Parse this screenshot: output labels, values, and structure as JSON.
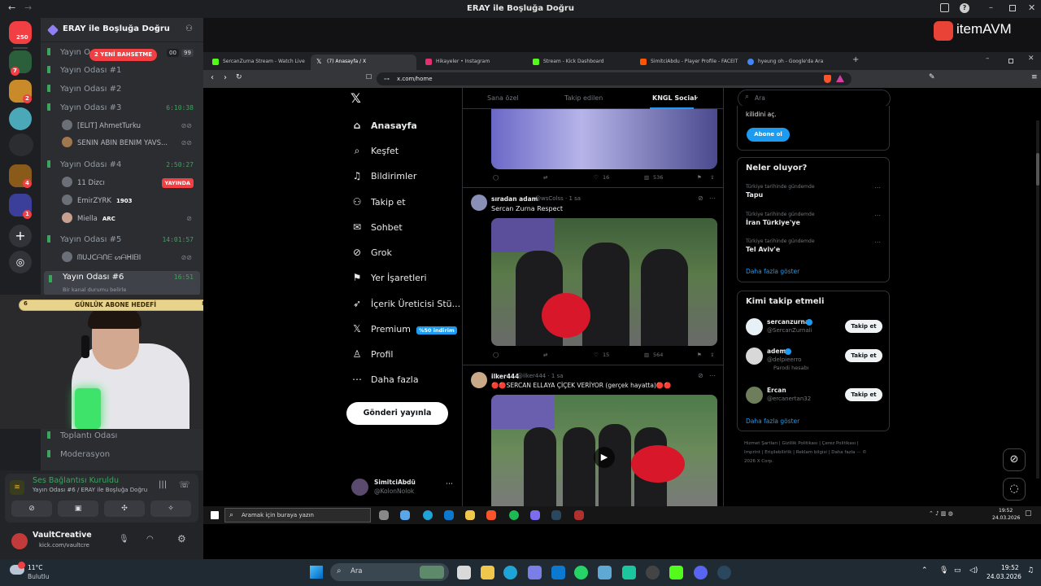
{
  "window": {
    "title": "ERAY ile Boşluğa Doğru"
  },
  "brand": {
    "name": "itemAVM",
    "accent": "#e84336"
  },
  "servers": {
    "home_badge": "250",
    "badges": [
      "7",
      "4",
      "2",
      "4",
      "1"
    ]
  },
  "channels": {
    "server_name": "ERAY ile Boşluğa Doğru",
    "new_mentions": "2 YENİ BAHSETME",
    "stage_count_a": "00",
    "stage_count_b": "99",
    "items": [
      {
        "label": "Yayın O",
        "time": ""
      },
      {
        "label": "Yayın Odası #1",
        "time": ""
      },
      {
        "label": "Yayın Odası #2",
        "time": ""
      },
      {
        "label": "Yayın Odası #3",
        "time": "6:10:38"
      },
      {
        "label": "Yayın Odası #4",
        "time": "2:50:27"
      },
      {
        "label": "Yayın Odası #5",
        "time": "14:01:57"
      },
      {
        "label": "Yayın Odası #6",
        "time": "16:51"
      },
      {
        "label": "Toplantı Odası",
        "time": ""
      },
      {
        "label": "Moderasyon",
        "time": ""
      }
    ],
    "room3_users": [
      "[ELIT] AhmetTurku",
      "SENIN ABIN BENIM YAVS..."
    ],
    "room4_users": [
      "11 Dizcı",
      "EmirZYRK",
      "Miella"
    ],
    "room4_badges": [
      "YAYINDA",
      "1903",
      "ARC"
    ],
    "room5_users": [
      "ᗰᑌᒍᑕᗩᑎᗴ ᔕᗩᕼIᗷI"
    ],
    "room6_status": "Bir kanal durumu belirle"
  },
  "overlay": {
    "goal_text": "GÜNLÜK ABONE HEDEFİ",
    "goal_left": "6",
    "goal_right": "8"
  },
  "voice_panel": {
    "status": "Ses Bağlantısı Kuruldu",
    "location": "Yayın Odası #6 / ERAY ile Boşluğa Doğru",
    "username": "VaultCreative",
    "user_status": "kick.com/vaultcre"
  },
  "browser": {
    "tabs": [
      {
        "label": "SercanZurna Stream - Watch Live",
        "color": "#53fc18"
      },
      {
        "label": "(7) Anasayfa / X",
        "color": "#ffffff"
      },
      {
        "label": "Hikayeler • Instagram",
        "color": "#e1306c"
      },
      {
        "label": "Stream - Kick Dashboard",
        "color": "#53fc18"
      },
      {
        "label": "SimitciAbdu - Player Profile - FACEIT",
        "color": "#ff5500"
      },
      {
        "label": "hyeung oh - Google'da Ara",
        "color": "#4285f4"
      }
    ],
    "url": "x.com/home"
  },
  "x": {
    "nav": [
      "Anasayfa",
      "Keşfet",
      "Bildirimler",
      "Takip et",
      "Sohbet",
      "Grok",
      "Yer İşaretleri",
      "İçerik Üreticisi Stü...",
      "Premium",
      "Profil",
      "Daha fazla"
    ],
    "premium_badge": "%50 indirim",
    "post_button": "Gönderi yayınla",
    "profile_name": "SimitciAbdü",
    "profile_handle": "@KolonNolok",
    "feed_tabs": [
      "Sana özel",
      "Takip edilen",
      "KNGL Social"
    ],
    "tweet0_stats": {
      "likes": "16",
      "views": "536"
    },
    "tweet1": {
      "name": "sıradan adam",
      "handle": "@wsColss · 1 sa",
      "text": "Sercan Zurna Respect",
      "likes": "15",
      "views": "564"
    },
    "tweet2": {
      "name": "ilker444",
      "handle": "@ilker444 · 1 sa",
      "text": "🔴🔴SERCAN ELLAYA ÇİÇEK VERİYOR (gerçek hayatta)🔴🔴"
    },
    "search_placeholder": "Ara",
    "subscribe_text": "kilidini aç.",
    "subscribe_button": "Abone ol",
    "trends_title": "Neler oluyor?",
    "trends": [
      {
        "meta": "Türkiye tarihinde gündemde",
        "name": "Tapu"
      },
      {
        "meta": "Türkiye tarihinde gündemde",
        "name": "İran Türkiye'ye"
      },
      {
        "meta": "Türkiye tarihinde gündemde",
        "name": "Tel Aviv'e"
      }
    ],
    "show_more": "Daha fazla göster",
    "wtf_title": "Kimi takip etmeli",
    "follow_label": "Takip et",
    "suggestions": [
      {
        "name": "sercanzurna",
        "handle": "@SercanZurnali",
        "extra": ""
      },
      {
        "name": "adem",
        "handle": "@delpieerro",
        "extra": "Parodi hesabı"
      },
      {
        "name": "Ercan",
        "handle": "@ercanertan32",
        "extra": ""
      }
    ],
    "footer": "Hizmet Şartları | Gizlilik Politikası | Çerez Politikası | Imprint | Erişilebilirlik | Reklam bilgisi | Daha fazla ··· © 2026 X Corp."
  },
  "taskbar1": {
    "search": "Aramak için buraya yazın",
    "time": "19:52",
    "date": "24.03.2026"
  },
  "taskbar2": {
    "weather_temp": "11°C",
    "weather_desc": "Bulutlu",
    "search": "Ara",
    "time": "19:52",
    "date": "24.03.2026"
  }
}
